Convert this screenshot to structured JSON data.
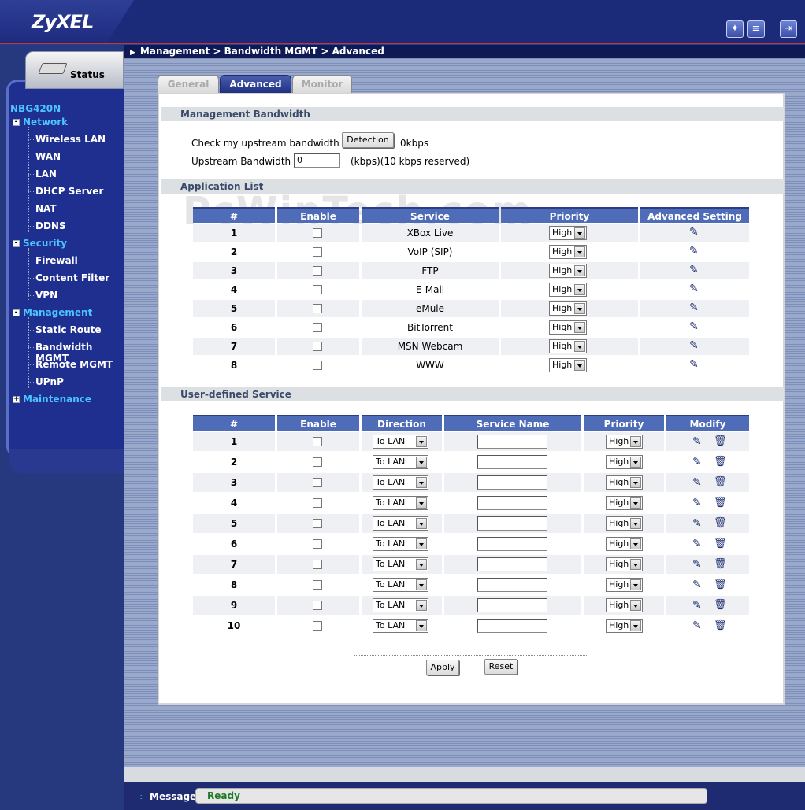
{
  "header": {
    "logo": "ZyXEL",
    "icons": [
      "wizard-icon",
      "about-icon",
      "logout-icon"
    ]
  },
  "breadcrumb": "Management > Bandwidth MGMT > Advanced",
  "sidebar": {
    "status_label": "Status",
    "model": "NBG420N",
    "sections": [
      {
        "label": "Network",
        "expander": "-",
        "items": [
          "Wireless LAN",
          "WAN",
          "LAN",
          "DHCP Server",
          "NAT",
          "DDNS"
        ]
      },
      {
        "label": "Security",
        "expander": "-",
        "items": [
          "Firewall",
          "Content Filter",
          "VPN"
        ]
      },
      {
        "label": "Management",
        "expander": "-",
        "items": [
          "Static Route",
          "Bandwidth MGMT",
          "Remote MGMT",
          "UPnP"
        ]
      },
      {
        "label": "Maintenance",
        "expander": "+",
        "items": []
      }
    ]
  },
  "tabs": [
    {
      "label": "General",
      "active": false
    },
    {
      "label": "Advanced",
      "active": true
    },
    {
      "label": "Monitor",
      "active": false
    }
  ],
  "mgmt_bandwidth": {
    "title": "Management Bandwidth",
    "check_label": "Check my upstream bandwidth",
    "detection_button": "Detection",
    "detected_value": "0kbps",
    "upstream_label": "Upstream Bandwidth",
    "upstream_value": "0",
    "upstream_unit": "(kbps)(10 kbps reserved)"
  },
  "app_list": {
    "title": "Application List",
    "columns": [
      "#",
      "Enable",
      "Service",
      "Priority",
      "Advanced Setting"
    ],
    "rows": [
      {
        "num": "1",
        "service": "XBox Live",
        "priority": "High"
      },
      {
        "num": "2",
        "service": "VoIP (SIP)",
        "priority": "High"
      },
      {
        "num": "3",
        "service": "FTP",
        "priority": "High"
      },
      {
        "num": "4",
        "service": "E-Mail",
        "priority": "High"
      },
      {
        "num": "5",
        "service": "eMule",
        "priority": "High"
      },
      {
        "num": "6",
        "service": "BitTorrent",
        "priority": "High"
      },
      {
        "num": "7",
        "service": "MSN Webcam",
        "priority": "High"
      },
      {
        "num": "8",
        "service": "WWW",
        "priority": "High"
      }
    ]
  },
  "user_service": {
    "title": "User-defined Service",
    "columns": [
      "#",
      "Enable",
      "Direction",
      "Service Name",
      "Priority",
      "Modify"
    ],
    "rows": [
      {
        "num": "1",
        "direction": "To LAN",
        "priority": "High"
      },
      {
        "num": "2",
        "direction": "To LAN",
        "priority": "High"
      },
      {
        "num": "3",
        "direction": "To LAN",
        "priority": "High"
      },
      {
        "num": "4",
        "direction": "To LAN",
        "priority": "High"
      },
      {
        "num": "5",
        "direction": "To LAN",
        "priority": "High"
      },
      {
        "num": "6",
        "direction": "To LAN",
        "priority": "High"
      },
      {
        "num": "7",
        "direction": "To LAN",
        "priority": "High"
      },
      {
        "num": "8",
        "direction": "To LAN",
        "priority": "High"
      },
      {
        "num": "9",
        "direction": "To LAN",
        "priority": "High"
      },
      {
        "num": "10",
        "direction": "To LAN",
        "priority": "High"
      }
    ]
  },
  "buttons": {
    "apply": "Apply",
    "reset": "Reset"
  },
  "footer": {
    "message_label": "Message",
    "message": "Ready"
  },
  "watermark": "PcWinTech.com",
  "colors": {
    "header": "#1c2a7a",
    "accent": "#4cc4ff",
    "table_header": "#4f6cb8",
    "status_ok": "#1e7a28"
  }
}
